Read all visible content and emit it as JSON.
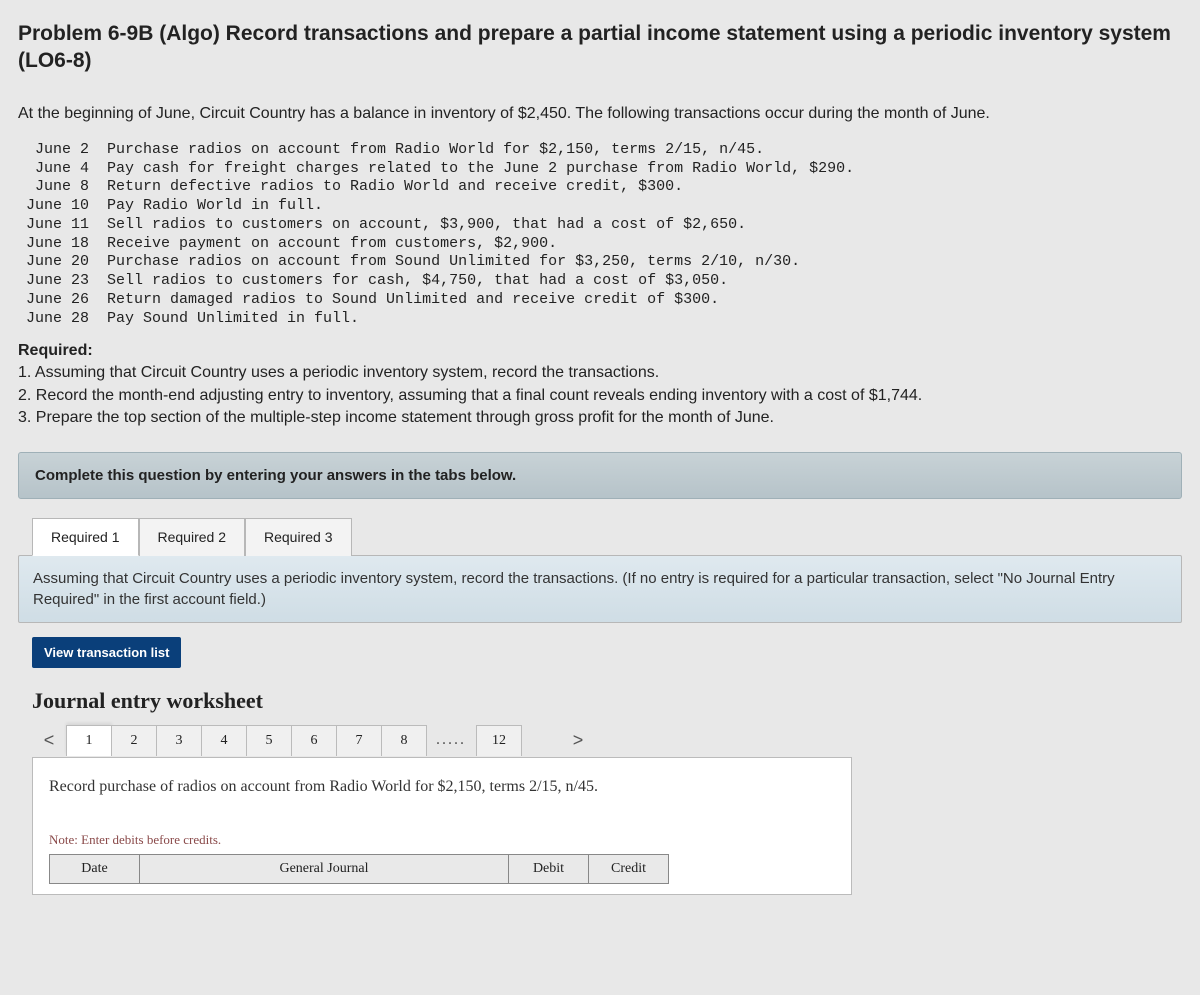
{
  "title": "Problem 6-9B (Algo) Record transactions and prepare a partial income statement using a periodic inventory system (LO6-8)",
  "intro": "At the beginning of June, Circuit Country has a balance in inventory of $2,450. The following transactions occur during the month of June.",
  "transactions": [
    " June 2  Purchase radios on account from Radio World for $2,150, terms 2/15, n/45.",
    " June 4  Pay cash for freight charges related to the June 2 purchase from Radio World, $290.",
    " June 8  Return defective radios to Radio World and receive credit, $300.",
    "June 10  Pay Radio World in full.",
    "June 11  Sell radios to customers on account, $3,900, that had a cost of $2,650.",
    "June 18  Receive payment on account from customers, $2,900.",
    "June 20  Purchase radios on account from Sound Unlimited for $3,250, terms 2/10, n/30.",
    "June 23  Sell radios to customers for cash, $4,750, that had a cost of $3,050.",
    "June 26  Return damaged radios to Sound Unlimited and receive credit of $300.",
    "June 28  Pay Sound Unlimited in full."
  ],
  "requiredHeading": "Required:",
  "requirements": [
    "1. Assuming that Circuit Country uses a periodic inventory system, record the transactions.",
    "2. Record the month-end adjusting entry to inventory, assuming that a final count reveals ending inventory with a cost of $1,744.",
    "3. Prepare the top section of the multiple-step income statement through gross profit for the month of June."
  ],
  "instructionBar": "Complete this question by entering your answers in the tabs below.",
  "tabs": {
    "r1": "Required 1",
    "r2": "Required 2",
    "r3": "Required 3"
  },
  "panelText": "Assuming that Circuit Country uses a periodic inventory system, record the transactions. (If no entry is required for a particular transaction, select \"No Journal Entry Required\" in the first account field.)",
  "viewBtn": "View transaction list",
  "worksheet": {
    "title": "Journal entry worksheet",
    "navLeft": "<",
    "navRight": ">",
    "tabs": [
      "1",
      "2",
      "3",
      "4",
      "5",
      "6",
      "7",
      "8"
    ],
    "dots": ".....",
    "lastTab": "12",
    "prompt": "Record purchase of radios on account from Radio World for $2,150, terms 2/15, n/45.",
    "note": "Note: Enter debits before credits.",
    "headers": {
      "date": "Date",
      "gj": "General Journal",
      "debit": "Debit",
      "credit": "Credit"
    }
  }
}
